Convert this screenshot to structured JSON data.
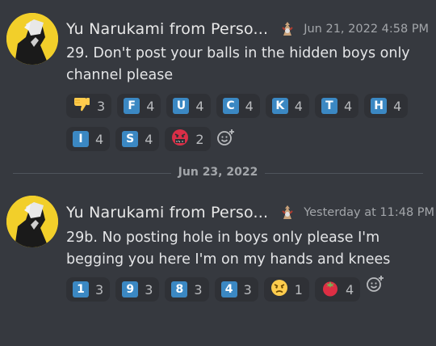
{
  "messages": [
    {
      "username": "Yu Narukami from Perso...",
      "timestamp": "Jun 21, 2022 4:58 PM",
      "content": "29. Don't post your balls in the hidden boys only channel please",
      "reactions": [
        {
          "emoji": "thumbs-down",
          "count": "3"
        },
        {
          "emoji": "regional-f",
          "letter": "F",
          "count": "4"
        },
        {
          "emoji": "regional-u",
          "letter": "U",
          "count": "4"
        },
        {
          "emoji": "regional-c",
          "letter": "C",
          "count": "4"
        },
        {
          "emoji": "regional-k",
          "letter": "K",
          "count": "4"
        },
        {
          "emoji": "regional-t",
          "letter": "T",
          "count": "4"
        },
        {
          "emoji": "regional-h",
          "letter": "H",
          "count": "4"
        },
        {
          "emoji": "regional-i",
          "letter": "I",
          "count": "4"
        },
        {
          "emoji": "regional-s",
          "letter": "S",
          "count": "4"
        },
        {
          "emoji": "cursing-face",
          "count": "2"
        }
      ]
    },
    {
      "username": "Yu Narukami from Perso...",
      "timestamp": "Yesterday at 11:48 PM",
      "content": "29b. No posting hole in boys only please I'm begging you here I'm on my hands and knees",
      "reactions": [
        {
          "emoji": "keycap-1",
          "letter": "1",
          "count": "3"
        },
        {
          "emoji": "keycap-9",
          "letter": "9",
          "count": "3"
        },
        {
          "emoji": "keycap-8",
          "letter": "8",
          "count": "3"
        },
        {
          "emoji": "keycap-4",
          "letter": "4",
          "count": "3"
        },
        {
          "emoji": "angry-face",
          "count": "1"
        },
        {
          "emoji": "tomato",
          "count": "4"
        }
      ]
    }
  ],
  "divider": {
    "date": "Jun 23, 2022"
  },
  "colors": {
    "background": "#36393f",
    "reaction_bg": "#2f3136",
    "keycap_blue": "#3b88c3"
  }
}
